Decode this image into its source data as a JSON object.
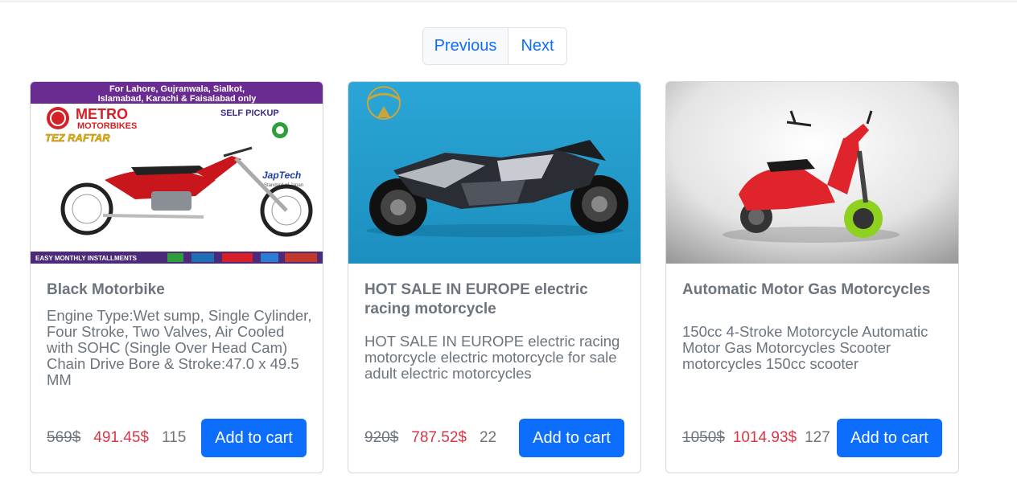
{
  "pagination": {
    "previous_label": "Previous",
    "next_label": "Next"
  },
  "products": [
    {
      "title": "Black Motorbike",
      "description": "Engine Type:Wet sump, Single Cylinder, Four Stroke, Two Valves, Air Cooled with SOHC (Single Over Head Cam) Chain Drive Bore & Stroke:47.0 x 49.5 MM",
      "old_price": "569$",
      "new_price": "491.45$",
      "stock": "115",
      "cart_label": "Add to cart",
      "image": {
        "banner_line1": "For Lahore, Gujranwala, Sialkot,",
        "banner_line2": "Islamabad, Karachi & Faisalabad only",
        "brand_line1": "METRO",
        "brand_line2": "MOTORBIKES",
        "model_name": "TEZ RAFTAR",
        "pickup": "SELF PICKUP",
        "partner": "JapTech",
        "partner_sub": "Standard of Japan",
        "footer": "EASY MONTHLY INSTALLMENTS"
      }
    },
    {
      "title": "HOT SALE IN EUROPE electric racing motorcycle",
      "description": "HOT SALE IN EUROPE electric racing motorcycle electric motorcycle for sale adult electric motorcycles",
      "old_price": "920$",
      "new_price": "787.52$",
      "stock": "22",
      "cart_label": "Add to cart"
    },
    {
      "title": "Automatic Motor Gas Motorcycles",
      "description": "150cc 4-Stroke Motorcycle Automatic Motor Gas Motorcycles Scooter motorcycles 150cc scooter",
      "old_price": "1050$",
      "new_price": "1014.93$",
      "stock": "127",
      "cart_label": "Add to cart"
    }
  ],
  "colors": {
    "primary": "#0d6efd",
    "sale_price": "#dc3545",
    "muted_text": "#6c757d",
    "banner_purple": "#6b2c91",
    "card2_bg": "#2aa0cf"
  }
}
